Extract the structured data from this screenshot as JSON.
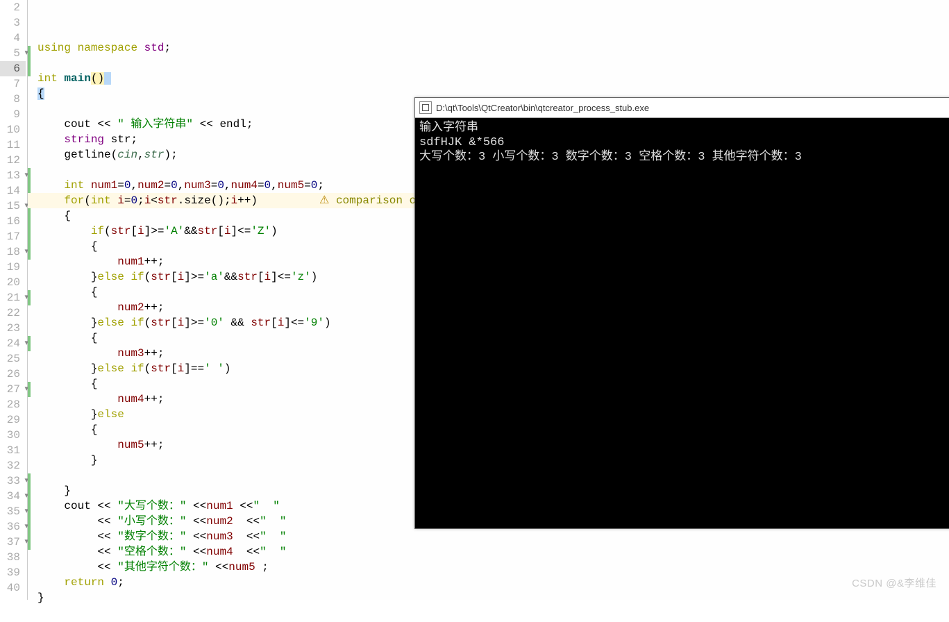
{
  "gutter": {
    "start": 2,
    "end": 40,
    "current": 6,
    "fold": [
      5,
      13,
      15,
      18,
      21,
      24,
      27,
      33,
      34,
      35,
      36,
      37
    ]
  },
  "greenbars": [
    {
      "from": 5,
      "to": 6
    },
    {
      "from": 13,
      "to": 18
    },
    {
      "from": 21,
      "to": 21
    },
    {
      "from": 24,
      "to": 24
    },
    {
      "from": 27,
      "to": 27
    },
    {
      "from": 33,
      "to": 37
    }
  ],
  "code": {
    "l2": "",
    "l3": {
      "a": "using",
      "b": " ",
      "c": "namespace",
      "d": " ",
      "e": "std",
      "f": ";"
    },
    "l4": "",
    "l5": {
      "a": "int",
      "b": " ",
      "c": "main",
      "d": "(",
      "e": ")",
      "f": " "
    },
    "l6": "{",
    "l7": "",
    "l8": {
      "a": "cout",
      "b": " << ",
      "c": "\" 输入字符串\"",
      "d": " << ",
      "e": "endl",
      "f": ";"
    },
    "l9": {
      "a": "string",
      "b": " ",
      "c": "str",
      "d": ";"
    },
    "l10": {
      "a": "getline",
      "b": "(",
      "c": "cin",
      "d": ",",
      "e": "str",
      "f": ");"
    },
    "l11": "",
    "l12": {
      "a": "int",
      "b": " ",
      "c": "num1",
      "d": "=",
      "e": "0",
      "f": ",",
      "g": "num2",
      "h": "=",
      "i": "0",
      "j": ",",
      "k": "num3",
      "l": "=",
      "m": "0",
      "n": ",",
      "o": "num4",
      "p": "=",
      "q": "0",
      "r": ",",
      "s": "num5",
      "t": "=",
      "u": "0",
      "v": ";"
    },
    "l13": {
      "a": "for",
      "b": "(",
      "c": "int",
      "d": " ",
      "e": "i",
      "f": "=",
      "g": "0",
      "h": ";",
      "i": "i",
      "j": "<",
      "k": "str",
      "l": ".",
      "m": "size",
      "n": "();",
      "o": "i",
      "p": "++)",
      "warnicon": "⚠",
      "warn": "comparison of i"
    },
    "l14": "    {",
    "l15": {
      "a": "if",
      "b": "(",
      "c": "str",
      "d": "[",
      "e": "i",
      "f": "]>=",
      "g": "'A'",
      "h": "&&",
      "i": "str",
      "j": "[",
      "k": "i",
      "l": "]<=",
      "m": "'Z'",
      "n": ")"
    },
    "l16": "        {",
    "l17": {
      "a": "num1",
      "b": "++;"
    },
    "l18": {
      "a": "}",
      "b": "else",
      "c": " ",
      "d": "if",
      "e": "(",
      "f": "str",
      "g": "[",
      "h": "i",
      "i": "]>=",
      "j": "'a'",
      "k": "&&",
      "l": "str",
      "m": "[",
      "n": "i",
      "o": "]<=",
      "p": "'z'",
      "q": ")"
    },
    "l19": "        {",
    "l20": {
      "a": "num2",
      "b": "++;"
    },
    "l21": {
      "a": "}",
      "b": "else",
      "c": " ",
      "d": "if",
      "e": "(",
      "f": "str",
      "g": "[",
      "h": "i",
      "i": "]>=",
      "j": "'0'",
      "k": " && ",
      "l": "str",
      "m": "[",
      "n": "i",
      "o": "]<=",
      "p": "'9'",
      "q": ")"
    },
    "l22": "        {",
    "l23": {
      "a": "num3",
      "b": "++;"
    },
    "l24": {
      "a": "}",
      "b": "else",
      "c": " ",
      "d": "if",
      "e": "(",
      "f": "str",
      "g": "[",
      "h": "i",
      "i": "]==",
      "j": "' '",
      "k": ")"
    },
    "l25": "        {",
    "l26": {
      "a": "num4",
      "b": "++;"
    },
    "l27": {
      "a": "}",
      "b": "else"
    },
    "l28": "        {",
    "l29": {
      "a": "num5",
      "b": "++;"
    },
    "l30": "        }",
    "l31": "",
    "l32": "    }",
    "l33": {
      "a": "cout",
      "b": " << ",
      "c": "\"大写个数：\"",
      "d": " <<",
      "e": "num1",
      "f": " <<",
      "g": "\"  \""
    },
    "l34": {
      "a": "<< ",
      "b": "\"小写个数：\"",
      "c": " <<",
      "d": "num2",
      "e": "  <<",
      "f": "\"  \""
    },
    "l35": {
      "a": "<< ",
      "b": "\"数字个数：\"",
      "c": " <<",
      "d": "num3",
      "e": "  <<",
      "f": "\"  \""
    },
    "l36": {
      "a": "<< ",
      "b": "\"空格个数：\"",
      "c": " <<",
      "d": "num4",
      "e": "  <<",
      "f": "\"  \""
    },
    "l37": {
      "a": "<< ",
      "b": "\"其他字符个数：\"",
      "c": " <<",
      "d": "num5",
      "e": " ;"
    },
    "l38": {
      "a": "return",
      "b": " ",
      "c": "0",
      "d": ";"
    },
    "l39": "}",
    "l40": ""
  },
  "console": {
    "title": "D:\\qt\\Tools\\QtCreator\\bin\\qtcreator_process_stub.exe",
    "line1": " 输入字符串",
    "line2": "sdfHJK &*566",
    "line3": "大写个数：3  小写个数：3  数字个数：3  空格个数：3  其他字符个数：3"
  },
  "watermark": "CSDN @&李维佳"
}
